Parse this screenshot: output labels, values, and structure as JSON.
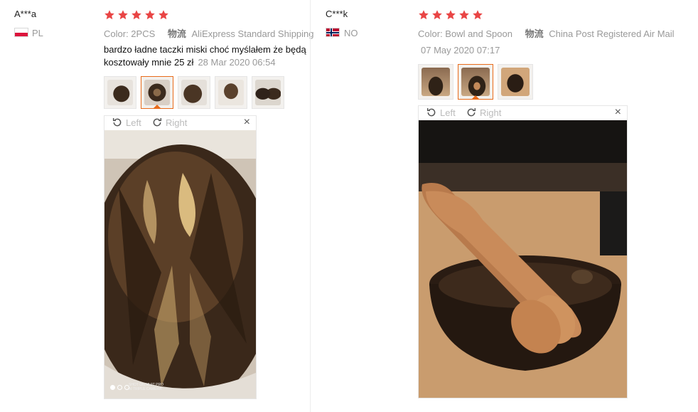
{
  "reviews": [
    {
      "user": "A***a",
      "country": "PL",
      "flag": "poland-flag-icon",
      "rating": 5,
      "color_label": "Color: 2PCS",
      "shipping_zh": "物流",
      "shipping": "AliExpress Standard Shipping",
      "text_line1": "bardzo ładne taczki miski choć myślałem że będą",
      "text_line2": "kosztowały mnie 25 zł",
      "date": "28 Mar 2020 06:54",
      "thumb_count": 5,
      "active_thumb": 2,
      "viewer": {
        "left_label": "Left",
        "right_label": "Right",
        "close": "×",
        "photo_watermark_line1": "SHOT ON MI 9T PRO",
        "photo_watermark_line2": "AI TRIPLE CAMERA"
      }
    },
    {
      "user": "C***k",
      "country": "NO",
      "flag": "norway-flag-icon",
      "rating": 5,
      "color_label": "Color: Bowl and Spoon",
      "shipping_zh": "物流",
      "shipping": "China Post Registered Air Mail",
      "date": "07 May 2020 07:17",
      "thumb_count": 3,
      "active_thumb": 2,
      "viewer": {
        "left_label": "Left",
        "right_label": "Right",
        "close": "×"
      }
    }
  ],
  "colors": {
    "star": "#e94545",
    "accent": "#e86b1a"
  }
}
